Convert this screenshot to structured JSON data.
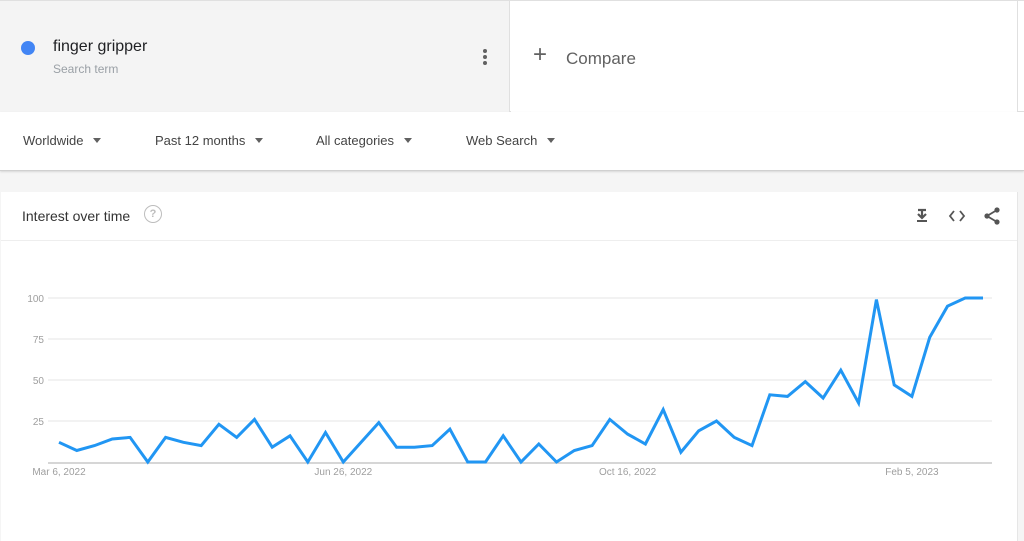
{
  "search_term": {
    "name": "finger gripper",
    "subtitle": "Search term",
    "color": "#4285f4",
    "more_icon": "more-vert-icon"
  },
  "compare": {
    "icon": "plus-icon",
    "label": "Compare"
  },
  "filters": [
    {
      "label": "Worldwide",
      "icon": "caret-down-icon"
    },
    {
      "label": "Past 12 months",
      "icon": "caret-down-icon"
    },
    {
      "label": "All categories",
      "icon": "caret-down-icon"
    },
    {
      "label": "Web Search",
      "icon": "caret-down-icon"
    }
  ],
  "card": {
    "title": "Interest over time",
    "help_icon": "help-icon",
    "help_glyph": "?",
    "actions": [
      "download-icon",
      "embed-code-icon",
      "share-icon"
    ]
  },
  "chart_data": {
    "type": "line",
    "title": "Interest over time",
    "xlabel": "",
    "ylabel": "",
    "ylim": [
      0,
      100
    ],
    "yticks": [
      25,
      50,
      75,
      100
    ],
    "grid": true,
    "line_color": "#2196f3",
    "x_start": "Mar 6, 2022",
    "x_tick_labels": [
      {
        "label": "Mar 6, 2022",
        "index": 0
      },
      {
        "label": "Jun 26, 2022",
        "index": 16
      },
      {
        "label": "Oct 16, 2022",
        "index": 32
      },
      {
        "label": "Feb 5, 2023",
        "index": 48
      }
    ],
    "series": [
      {
        "name": "finger gripper",
        "values": [
          12,
          7,
          10,
          14,
          15,
          0,
          15,
          12,
          10,
          23,
          15,
          26,
          9,
          16,
          0,
          18,
          0,
          12,
          24,
          9,
          9,
          10,
          20,
          0,
          0,
          16,
          0,
          11,
          0,
          7,
          10,
          26,
          17,
          11,
          32,
          6,
          19,
          25,
          15,
          10,
          41,
          40,
          49,
          39,
          56,
          36,
          99,
          47,
          40,
          76,
          95,
          100,
          100
        ]
      }
    ]
  }
}
